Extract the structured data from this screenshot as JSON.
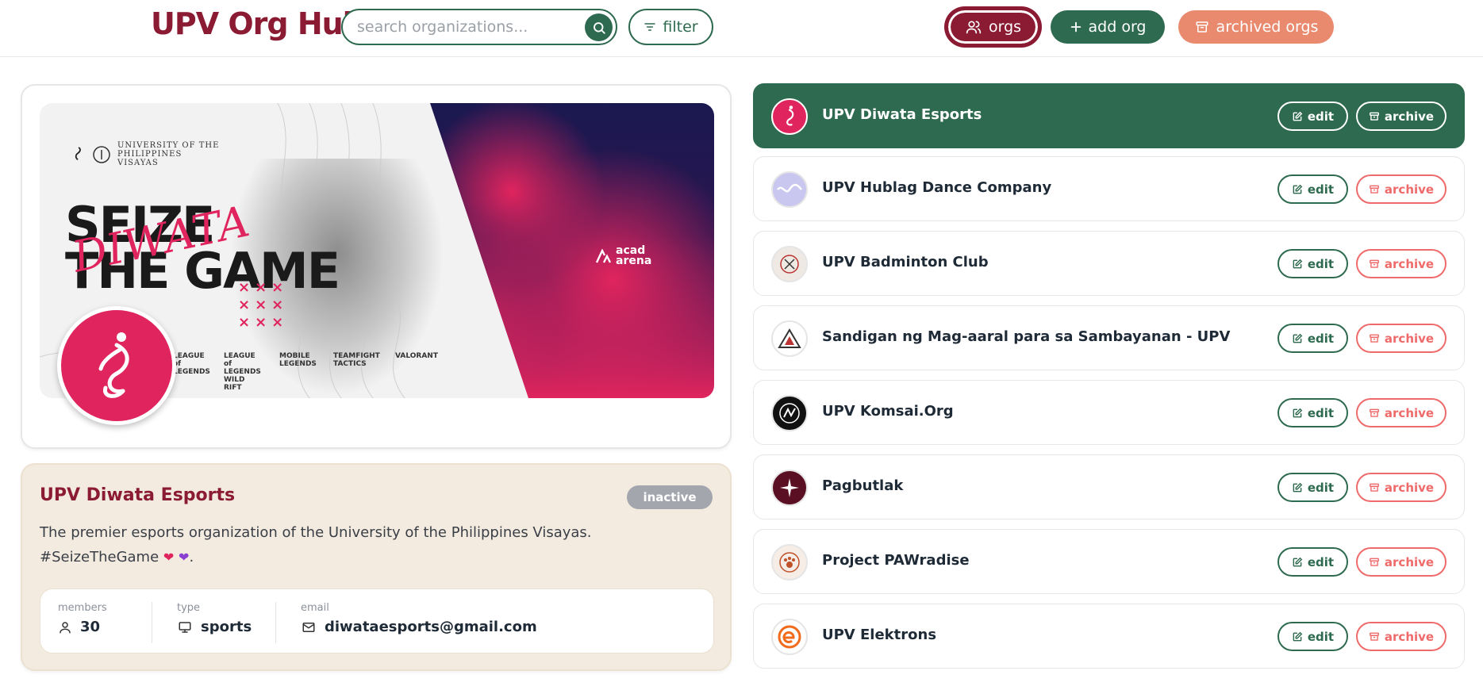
{
  "header": {
    "brand": "UPV Org Hub",
    "search_placeholder": "search organizations...",
    "filter_label": "filter",
    "orgs_label": "orgs",
    "add_org_label": "add org",
    "archived_label": "archived orgs"
  },
  "colors": {
    "primary_maroon": "#8b1a33",
    "primary_green": "#2e6a4f",
    "accent_salmon": "#e98a6f",
    "archive_red": "#ef6a6a",
    "diwata_pink": "#e0245e",
    "info_bg": "#f3ebdf"
  },
  "banner": {
    "university": "UNIVERSITY OF THE PHILIPPINES VISAYAS",
    "headline_line1": "SEIZE",
    "headline_line2": "THE GAME",
    "script_text": "DIWATA",
    "x_marks_row": "×××",
    "sponsor": "acad arena",
    "games": [
      "LEAGUE of LEGENDS",
      "LEAGUE of LEGENDS WILD RIFT",
      "MOBILE LEGENDS",
      "TEAMFIGHT TACTICS",
      "VALORANT"
    ]
  },
  "selected": {
    "name": "UPV Diwata Esports",
    "status": "inactive",
    "description": "The premier esports organization of the University of the Philippines Visayas. #SeizeTheGame",
    "description_tail": ".",
    "members_label": "members",
    "members": "30",
    "type_label": "type",
    "type": "sports",
    "email_label": "email",
    "email": "diwataesports@gmail.com"
  },
  "list": {
    "edit_label": "edit",
    "archive_label": "archive",
    "orgs": [
      {
        "name": "UPV Diwata Esports",
        "avatar_color": "#e0245e",
        "active": true
      },
      {
        "name": "UPV Hublag Dance Company",
        "avatar_color": "#c9c6f0",
        "active": false
      },
      {
        "name": "UPV Badminton Club",
        "avatar_color": "#efe9e4",
        "active": false
      },
      {
        "name": "Sandigan ng Mag-aaral para sa Sambayanan - UPV",
        "avatar_color": "#ffffff",
        "active": false
      },
      {
        "name": "UPV Komsai.Org",
        "avatar_color": "#111111",
        "active": false
      },
      {
        "name": "Pagbutlak",
        "avatar_color": "#5a0f22",
        "active": false
      },
      {
        "name": "Project PAWradise",
        "avatar_color": "#f6ede6",
        "active": false
      },
      {
        "name": "UPV Elektrons",
        "avatar_color": "#ffffff",
        "active": false
      }
    ]
  },
  "icons": {
    "search": "search-icon",
    "filter": "filter-lines-icon",
    "orgs": "users-icon",
    "add": "plus-icon",
    "archive": "archive-box-icon",
    "edit": "pencil-square-icon",
    "members": "user-icon",
    "type": "monitor-icon",
    "email": "mail-icon"
  }
}
